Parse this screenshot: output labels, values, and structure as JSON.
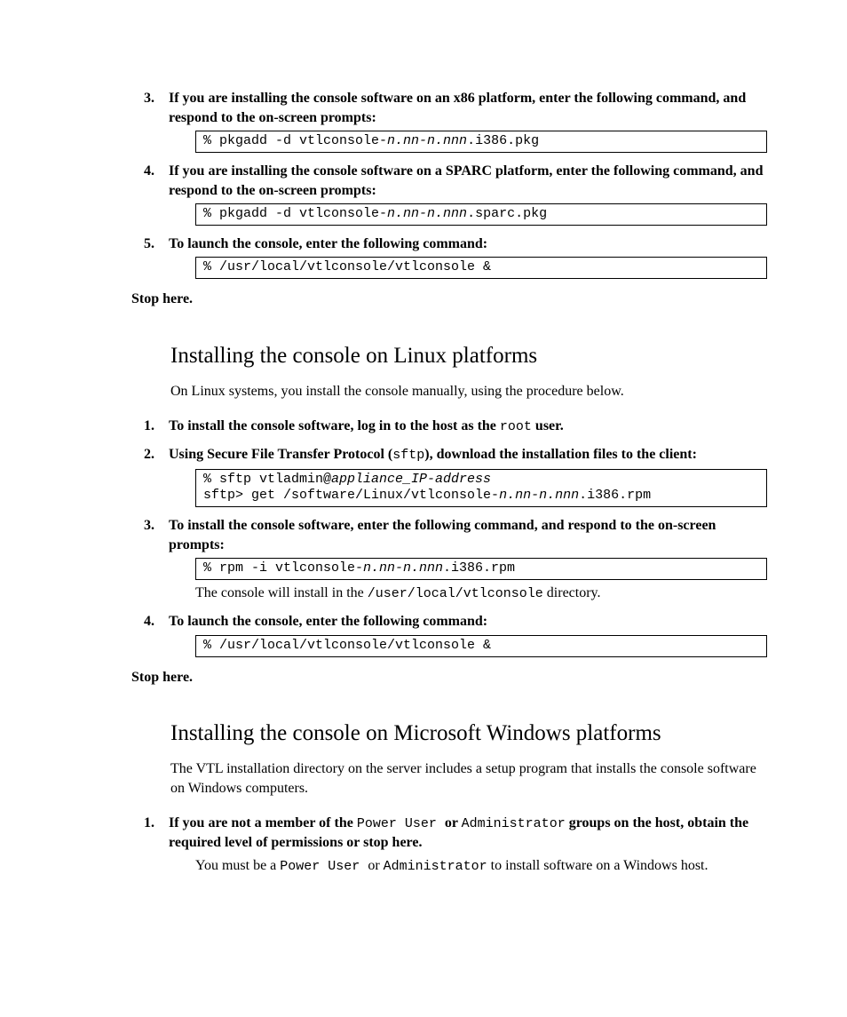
{
  "sec1": {
    "steps": [
      {
        "n": "3.",
        "t1": "If you are installing the console software on an x86 platform, enter the following command, and respond to the on-screen prompts:",
        "code_pre": "% pkgadd -d vtlconsole-",
        "code_var": "n.nn-n.nnn",
        "code_post": ".i386.pkg"
      },
      {
        "n": "4.",
        "t1": "If you are installing the console software on a SPARC platform, enter the following command, and respond to the on-screen prompts:",
        "code_pre": "% pkgadd -d vtlconsole-",
        "code_var": "n.nn-n.nnn",
        "code_post": ".sparc.pkg"
      },
      {
        "n": "5.",
        "t1": "To launch the console, enter the following command:",
        "code_pre": "% /usr/local/vtlconsole/vtlconsole &",
        "code_var": "",
        "code_post": ""
      }
    ],
    "stop": "Stop here."
  },
  "sec2": {
    "heading": "Installing the console on Linux platforms",
    "intro": "On Linux systems, you install the console manually, using the procedure below.",
    "step1": {
      "n": "1.",
      "pre": "To install the console software, log in to the host as the ",
      "mono": "root",
      "post": " user."
    },
    "step2": {
      "n": "2.",
      "pre": "Using Secure File Transfer Protocol (",
      "mono": "sftp",
      "post": "), download the installation files to the client:",
      "code_l1a": "% sftp vtladmin@",
      "code_l1b": "appliance_IP-address",
      "code_l2a": "sftp> get /software/Linux/vtlconsole-",
      "code_l2b": "n.nn-n.nnn",
      "code_l2c": ".i386.rpm"
    },
    "step3": {
      "n": "3.",
      "t": "To install the console software, enter the following command, and respond to the on-screen prompts:",
      "code_a": "% rpm -i vtlconsole-",
      "code_b": "n.nn-n.nnn",
      "code_c": ".i386.rpm",
      "body_a": "The console will install in the ",
      "body_b": "/user/local/vtlconsole",
      "body_c": " directory."
    },
    "step4": {
      "n": "4.",
      "t": "To launch the console, enter the following command:",
      "code": "% /usr/local/vtlconsole/vtlconsole &"
    },
    "stop": "Stop here."
  },
  "sec3": {
    "heading": "Installing the console on Microsoft Windows platforms",
    "intro": "The VTL installation directory on the server includes a setup program that installs the console software on Windows computers.",
    "step1": {
      "n": "1.",
      "a": "If you are not a member of the ",
      "m1": "Power User ",
      "b": " or ",
      "m2": "Administrator",
      "c": " groups on the host, obtain the required level of permissions or stop here.",
      "body_a": "You must be a ",
      "body_m1": "Power User ",
      "body_b": " or ",
      "body_m2": "Administrator",
      "body_c": " to install software on a Windows host."
    }
  }
}
